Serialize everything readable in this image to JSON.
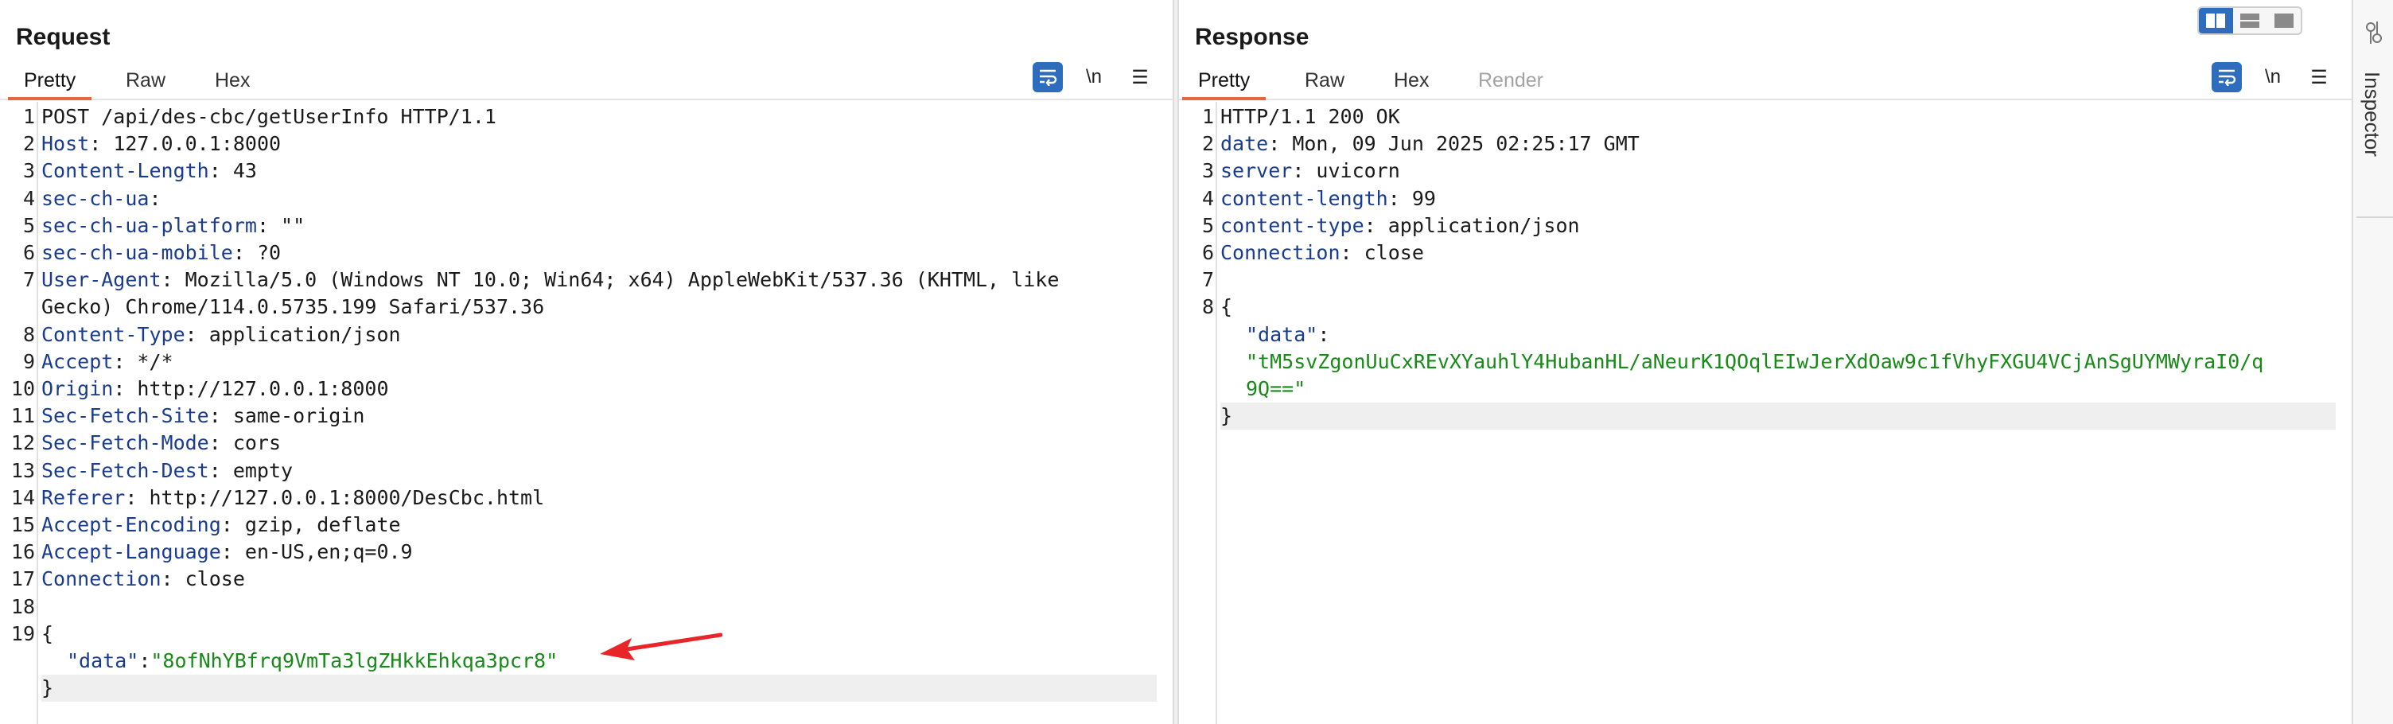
{
  "request": {
    "title": "Request",
    "tabs": [
      {
        "label": "Pretty",
        "active": true
      },
      {
        "label": "Raw",
        "active": false
      },
      {
        "label": "Hex",
        "active": false
      }
    ],
    "toolbar": {
      "newline_label": "\\n",
      "menu_label": "☰"
    },
    "lines": [
      {
        "num": "1",
        "plain": "POST /api/des-cbc/getUserInfo HTTP/1.1"
      },
      {
        "num": "2",
        "key": "Host",
        "value": "127.0.0.1:8000"
      },
      {
        "num": "3",
        "key": "Content-Length",
        "value": "43"
      },
      {
        "num": "4",
        "key": "sec-ch-ua",
        "value": ""
      },
      {
        "num": "5",
        "key": "sec-ch-ua-platform",
        "value": "\"\""
      },
      {
        "num": "6",
        "key": "sec-ch-ua-mobile",
        "value": "?0"
      },
      {
        "num": "7",
        "key": "User-Agent",
        "value": "Mozilla/5.0 (Windows NT 10.0; Win64; x64) AppleWebKit/537.36 (KHTML, like"
      },
      {
        "num": "",
        "plain": "Gecko) Chrome/114.0.5735.199 Safari/537.36"
      },
      {
        "num": "8",
        "key": "Content-Type",
        "value": "application/json"
      },
      {
        "num": "9",
        "key": "Accept",
        "value": "*/*"
      },
      {
        "num": "10",
        "key": "Origin",
        "value": "http://127.0.0.1:8000"
      },
      {
        "num": "11",
        "key": "Sec-Fetch-Site",
        "value": "same-origin"
      },
      {
        "num": "12",
        "key": "Sec-Fetch-Mode",
        "value": "cors"
      },
      {
        "num": "13",
        "key": "Sec-Fetch-Dest",
        "value": "empty"
      },
      {
        "num": "14",
        "key": "Referer",
        "value": "http://127.0.0.1:8000/DesCbc.html"
      },
      {
        "num": "15",
        "key": "Accept-Encoding",
        "value": "gzip, deflate"
      },
      {
        "num": "16",
        "key": "Accept-Language",
        "value": "en-US,en;q=0.9"
      },
      {
        "num": "17",
        "key": "Connection",
        "value": "close"
      },
      {
        "num": "18",
        "plain": ""
      },
      {
        "num": "19",
        "plain": "{"
      },
      {
        "num": "",
        "jkey": "\"data\"",
        "jsep": ":",
        "jstr": "\"8ofNhYBfrq9VmTa3lgZHkkEhkqa3pcr8\""
      },
      {
        "num": "",
        "plain": "}",
        "highlight": true
      }
    ]
  },
  "response": {
    "title": "Response",
    "tabs": [
      {
        "label": "Pretty",
        "active": true
      },
      {
        "label": "Raw",
        "active": false
      },
      {
        "label": "Hex",
        "active": false
      },
      {
        "label": "Render",
        "active": false,
        "disabled": true
      }
    ],
    "toolbar": {
      "newline_label": "\\n",
      "menu_label": "☰"
    },
    "lines": [
      {
        "num": "1",
        "plain": "HTTP/1.1 200 OK"
      },
      {
        "num": "2",
        "key": "date",
        "value": "Mon, 09 Jun 2025 02:25:17 GMT"
      },
      {
        "num": "3",
        "key": "server",
        "value": "uvicorn"
      },
      {
        "num": "4",
        "key": "content-length",
        "value": "99"
      },
      {
        "num": "5",
        "key": "content-type",
        "value": "application/json"
      },
      {
        "num": "6",
        "key": "Connection",
        "value": "close"
      },
      {
        "num": "7",
        "plain": ""
      },
      {
        "num": "8",
        "plain": "{"
      },
      {
        "num": "",
        "jkey": "\"data\"",
        "jsep": ":"
      },
      {
        "num": "",
        "jstr": "\"tM5svZgonUuCxREvXYauhlY4HubanHL/aNeurK1QOqlEIwJerXdOaw9c1fVhyFXGU4VCjAnSgUYMWyraI0/q"
      },
      {
        "num": "",
        "jstr": "9Q==\""
      },
      {
        "num": "",
        "plain": "}",
        "highlight": true
      }
    ]
  },
  "sidebar": {
    "inspector_label": "Inspector"
  },
  "colors": {
    "accent": "#2e6dbd",
    "tab_underline": "#e8663d",
    "header_key": "#1a3c8f",
    "json_string": "#178a17",
    "arrow": "#e8262a"
  }
}
